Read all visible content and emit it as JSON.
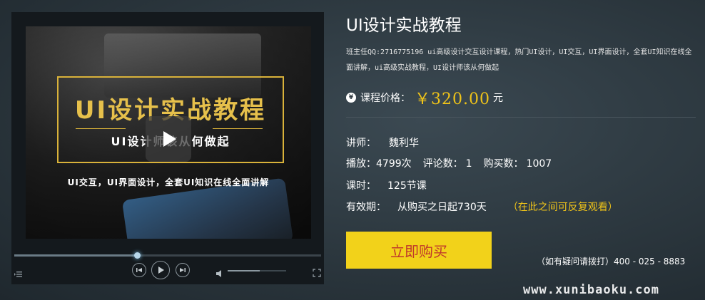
{
  "player": {
    "promo_title": "UI设计实战教程",
    "promo_subtitle": "UI设计师该从何做起",
    "promo_bottom": "UI交互，UI界面设计，全套UI知识在线全面讲解",
    "progress": 0.4,
    "volume": 0.55,
    "icons": {
      "play_overlay": "play-icon",
      "playlist": "playlist-icon",
      "prev": "previous-icon",
      "play": "play-icon",
      "next": "next-icon",
      "volume": "volume-icon",
      "fullscreen": "fullscreen-icon"
    }
  },
  "course": {
    "title": "UI设计实战教程",
    "description": "班主任QQ:2716775196 ui高级设计交互设计课程，热门UI设计，UI交互，UI界面设计，全套UI知识在线全面讲解，ui高级实战教程，UI设计师该从何做起",
    "price_label": "课程价格：",
    "price_value": "￥320.00",
    "price_unit": "元",
    "price_icon": "¥",
    "teacher_label": "讲师：",
    "teacher_name": "魏利华",
    "plays_label": "播放：",
    "plays_value": "4799次",
    "comments_label": "评论数：",
    "comments_value": "1",
    "purchases_label": "购买数：",
    "purchases_value": "1007",
    "lessons_label": "课时：",
    "lessons_value": "125节课",
    "validity_label": "有效期：",
    "validity_value": "从购买之日起730天",
    "validity_note": "（在此之间可反复观看）",
    "buy_label": "立即购买",
    "hotline": "（如有疑问请拨打）400 - 025 - 8883"
  },
  "watermark": "www.xunibaoku.com",
  "colors": {
    "accent_gold": "#f0c419",
    "buy_button_bg": "#f2d21a",
    "buy_button_text": "#c0392b",
    "promo_gold": "#e6c04b"
  }
}
